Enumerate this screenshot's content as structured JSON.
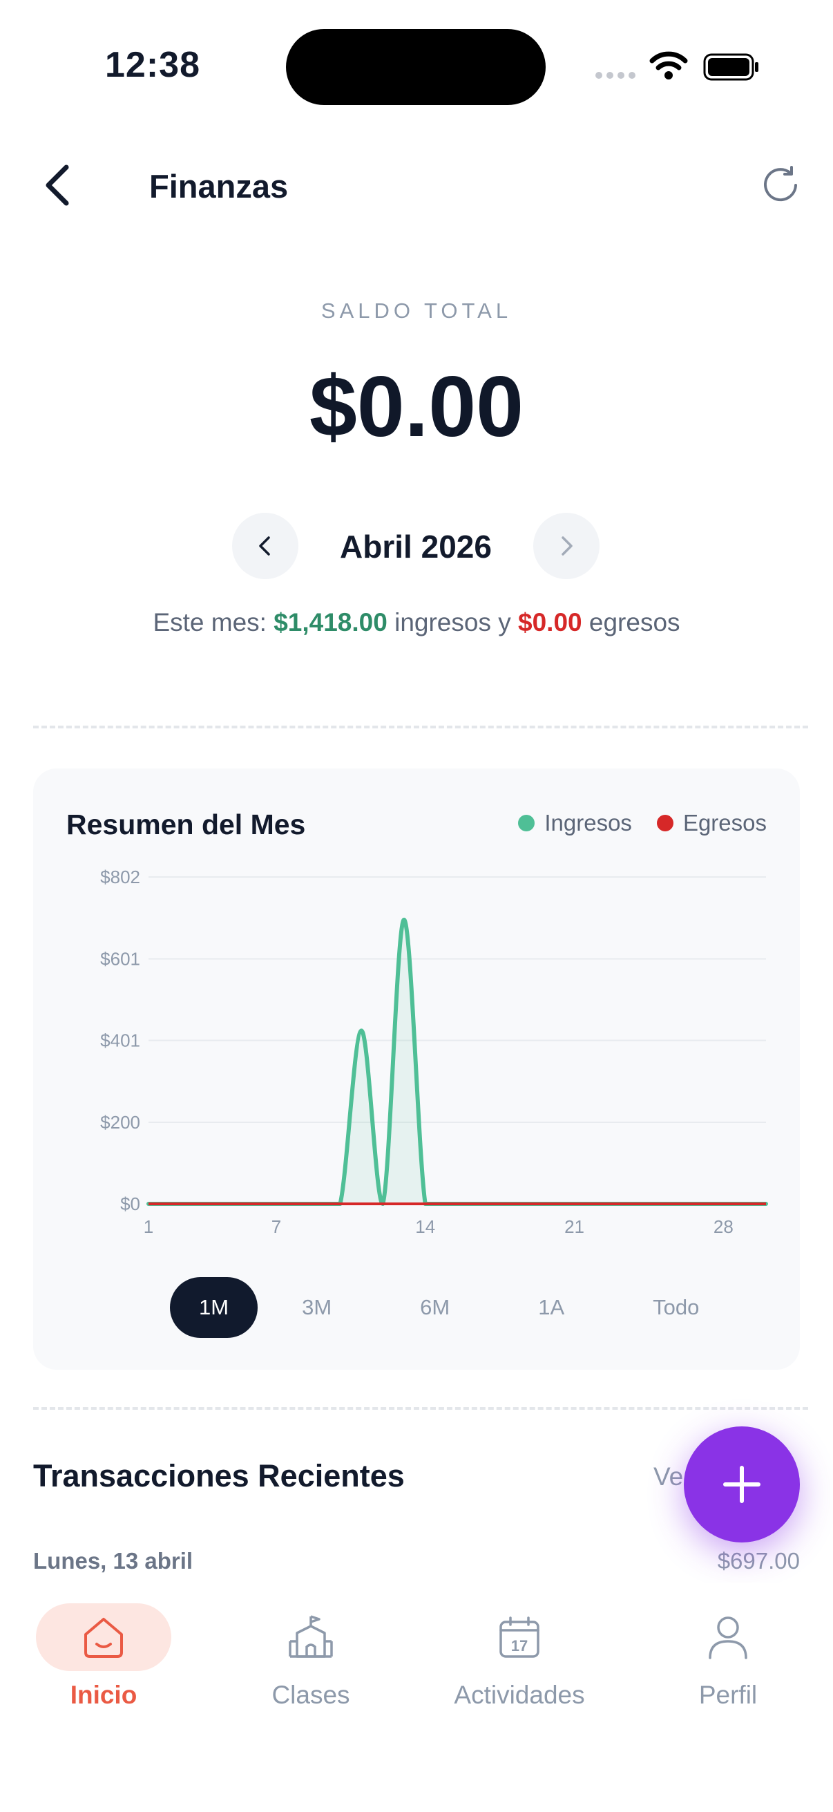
{
  "status_bar": {
    "time": "12:38"
  },
  "header": {
    "title": "Finanzas"
  },
  "balance": {
    "label": "SALDO TOTAL",
    "amount": "$0.00",
    "month": "Abril 2026",
    "summary": {
      "prefix": "Este mes: ",
      "income": "$1,418.00",
      "middle": " ingresos y ",
      "expense": "$0.00",
      "suffix": " egresos"
    }
  },
  "chart_card": {
    "title": "Resumen del Mes",
    "legend": [
      {
        "label": "Ingresos",
        "color": "#4fbf96"
      },
      {
        "label": "Egresos",
        "color": "#d62828"
      }
    ],
    "range_tabs": [
      "1M",
      "3M",
      "6M",
      "1A",
      "Todo"
    ],
    "active_range": "1M"
  },
  "chart_data": {
    "type": "line",
    "y_ticks": [
      "$0",
      "$200",
      "$401",
      "$601",
      "$802"
    ],
    "y_tick_values": [
      0,
      200,
      401,
      601,
      802
    ],
    "x_ticks": [
      "1",
      "7",
      "14",
      "21",
      "28"
    ],
    "x_tick_values": [
      1,
      7,
      14,
      21,
      28
    ],
    "xlim": [
      1,
      30
    ],
    "ylim": [
      0,
      802
    ],
    "grid": true,
    "legend_position": "top-right",
    "series": [
      {
        "name": "Ingresos",
        "color": "#4fbf96",
        "x": [
          1,
          2,
          3,
          4,
          5,
          6,
          7,
          8,
          9,
          10,
          11,
          12,
          13,
          14,
          15,
          16,
          17,
          18,
          19,
          20,
          21,
          22,
          23,
          24,
          25,
          26,
          27,
          28,
          29,
          30
        ],
        "y": [
          0,
          0,
          0,
          0,
          0,
          0,
          0,
          0,
          0,
          0,
          425,
          0,
          697,
          0,
          0,
          0,
          0,
          0,
          0,
          0,
          0,
          0,
          0,
          0,
          0,
          0,
          0,
          0,
          0,
          0
        ]
      },
      {
        "name": "Egresos",
        "color": "#d62828",
        "x": [
          1,
          30
        ],
        "y": [
          0,
          0
        ]
      }
    ]
  },
  "transactions": {
    "title": "Transacciones Recientes",
    "view_all": "Ve",
    "groups": [
      {
        "date": "Lunes, 13 abril",
        "total": "$697.00"
      }
    ]
  },
  "bottom_nav": [
    {
      "label": "Inicio",
      "icon": "home-icon",
      "active": true
    },
    {
      "label": "Clases",
      "icon": "school-icon",
      "active": false
    },
    {
      "label": "Actividades",
      "icon": "calendar-icon",
      "active": false,
      "icon_text": "17"
    },
    {
      "label": "Perfil",
      "icon": "user-icon",
      "active": false
    }
  ]
}
